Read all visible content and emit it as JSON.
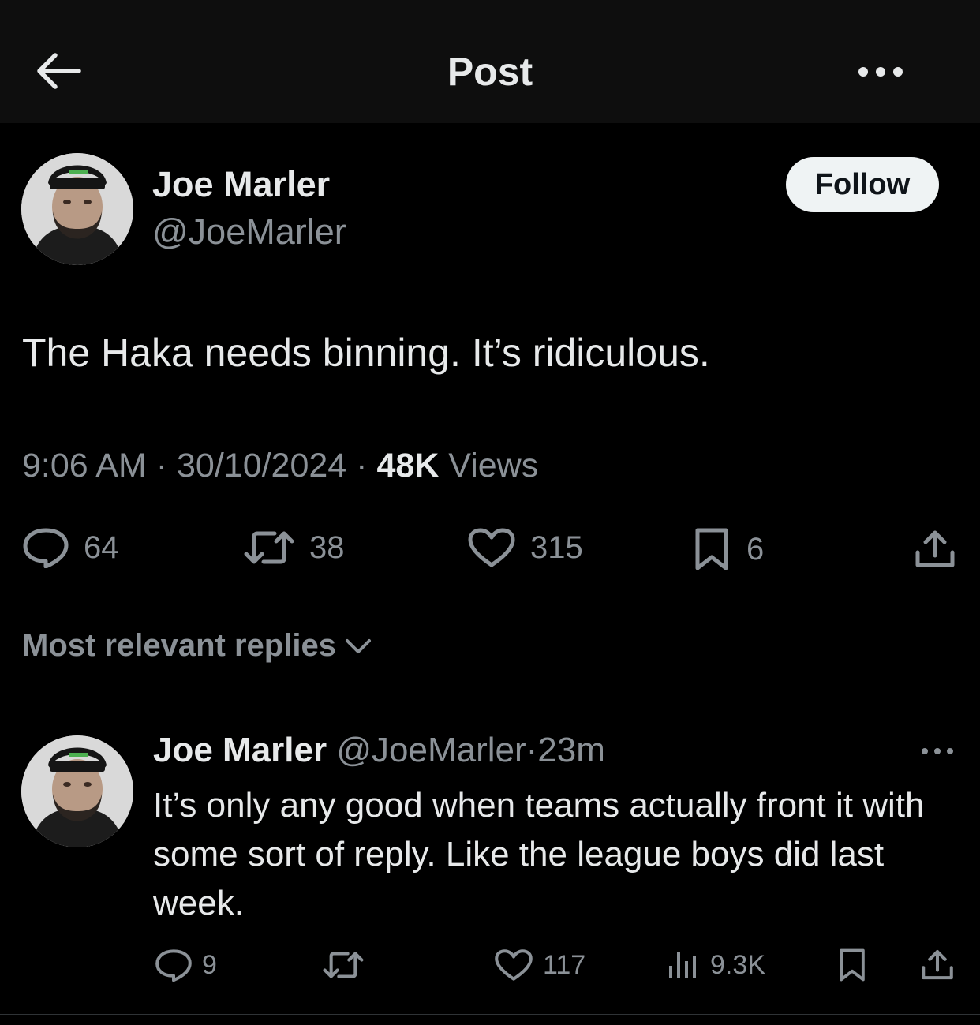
{
  "header": {
    "title": "Post"
  },
  "post": {
    "author": {
      "name": "Joe Marler",
      "handle": "@JoeMarler"
    },
    "follow_label": "Follow",
    "text": "The Haka needs binning. It’s ridiculous.",
    "time": "9:06 AM",
    "date": "30/10/2024",
    "separator": "·",
    "views_count": "48K",
    "views_label": "Views",
    "actions": {
      "replies": "64",
      "reposts": "38",
      "likes": "315",
      "bookmarks": "6"
    }
  },
  "replies_sort": {
    "label": "Most relevant replies"
  },
  "reply": {
    "author": {
      "name": "Joe Marler",
      "handle": "@JoeMarler"
    },
    "separator": "·",
    "time_ago": "23m",
    "text": "It’s only any good when teams actually front it with some sort of reply. Like the league boys did last week.",
    "actions": {
      "replies": "9",
      "reposts": "",
      "likes": "117",
      "views": "9.3K"
    }
  },
  "colors": {
    "background": "#000000",
    "topbar": "#0e0e0e",
    "text_primary": "#e7e9ea",
    "text_secondary": "#8b9197",
    "follow_bg": "#eff3f4",
    "divider": "#2f3336"
  },
  "icons": [
    "back-arrow-icon",
    "more-icon",
    "reply-icon",
    "repost-icon",
    "like-icon",
    "bookmark-icon",
    "share-icon",
    "views-icon",
    "chevron-down-icon"
  ]
}
